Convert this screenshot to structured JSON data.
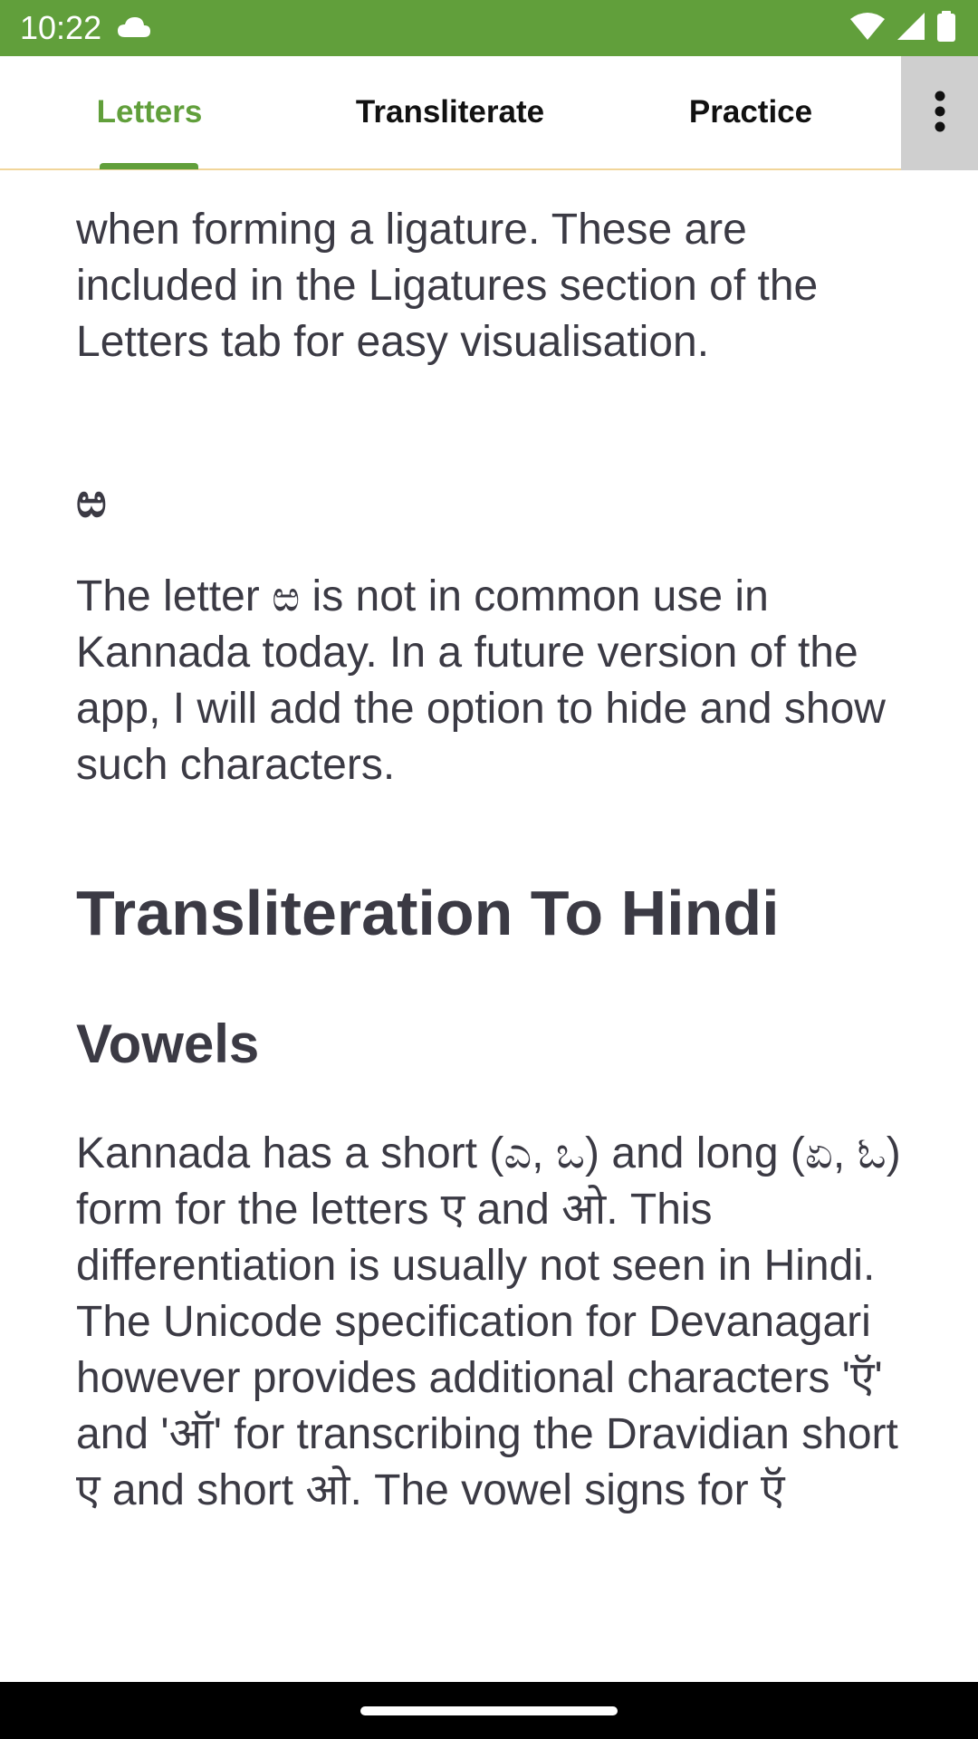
{
  "status_bar": {
    "time": "10:22",
    "background_color": "#619f3b",
    "icons": [
      "cloud-icon",
      "wifi-icon",
      "signal-icon",
      "battery-icon"
    ]
  },
  "tabs": [
    {
      "label": "Letters",
      "active": true
    },
    {
      "label": "Transliterate",
      "active": false
    },
    {
      "label": "Practice",
      "active": false
    }
  ],
  "colors": {
    "accent": "#619f3b",
    "text": "#3b3a44",
    "tab_divider": "#f1d59a",
    "overflow_bg": "#cfcfcf"
  },
  "content": {
    "para1": "when forming a ligature. These are included in the Ligatures section of the Letters tab for easy visualisation.",
    "letter_heading": "ಱ",
    "para2": "The letter ಱ is not in common use in Kannada today. In a future version of the app, I will add the option to hide and show such characters.",
    "heading_transliteration": "Transliteration To Hindi",
    "heading_vowels": "Vowels",
    "para3": "Kannada has a short (ಎ, ಒ) and long (ಏ, ಓ) form for the letters ए and ओ. This differentiation is usually not seen in Hindi. The Unicode specification for Devanagari however provides additional characters 'ऍ' and 'ऑ' for transcribing the Dravidian short ए and short ओ. The vowel signs for ऍ"
  }
}
